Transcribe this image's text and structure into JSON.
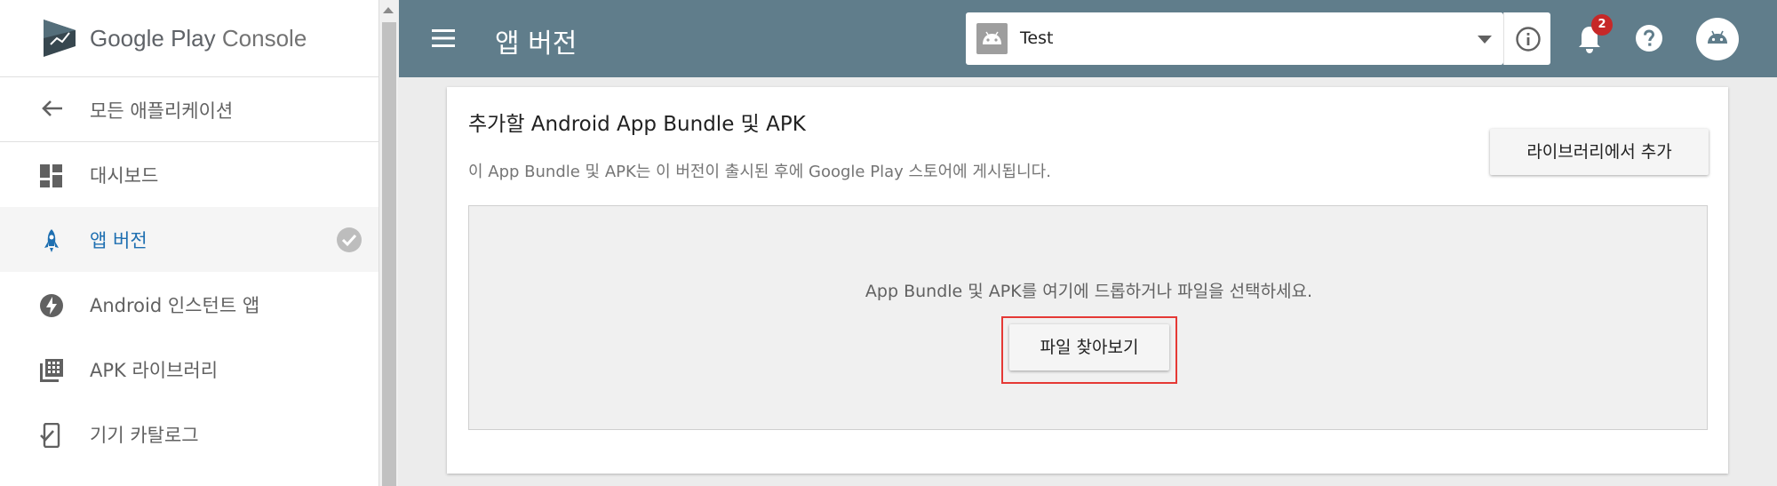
{
  "brand": {
    "logo_text_main": "Google Play",
    "logo_text_suffix": "Console"
  },
  "sidebar": {
    "back_label": "모든 애플리케이션",
    "items": [
      {
        "label": "대시보드",
        "icon": "dashboard-icon"
      },
      {
        "label": "앱 버전",
        "icon": "rocket-icon",
        "active": true,
        "status_icon": "check-circle-icon"
      },
      {
        "label": "Android 인스턴트 앱",
        "icon": "flash-icon"
      },
      {
        "label": "APK 라이브러리",
        "icon": "library-icon"
      },
      {
        "label": "기기 카탈로그",
        "icon": "device-catalog-icon"
      }
    ]
  },
  "header": {
    "title": "앱 버전",
    "app_selector_value": "Test",
    "notification_count": "2",
    "bg_color": "#607d8b"
  },
  "card": {
    "title": "추가할 Android App Bundle 및 APK",
    "subtitle": "이 App Bundle 및 APK는 이 버전이 출시된 후에 Google Play 스토어에 게시됩니다.",
    "library_button": "라이브러리에서 추가",
    "dropzone_text": "App Bundle 및 APK를 여기에 드롭하거나 파일을 선택하세요.",
    "browse_button": "파일 찾아보기",
    "highlight_color": "#e53935"
  },
  "colors": {
    "active_nav": "#1e6fb1"
  }
}
